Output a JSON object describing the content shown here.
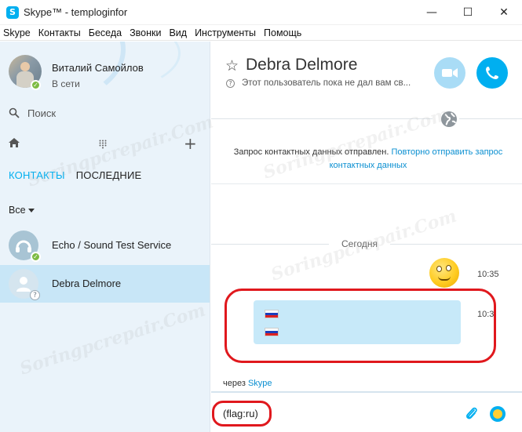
{
  "window": {
    "title": "Skype™ - temploginfor",
    "minimize": "—",
    "maximize": "☐",
    "close": "✕"
  },
  "menu": [
    "Skype",
    "Контакты",
    "Беседа",
    "Звонки",
    "Вид",
    "Инструменты",
    "Помощь"
  ],
  "profile": {
    "name": "Виталий Самойлов",
    "status": "В сети"
  },
  "search": {
    "label": "Поиск"
  },
  "tabs": {
    "contacts": "КОНТАКТЫ",
    "recent": "ПОСЛЕДНИЕ"
  },
  "filter": {
    "label": "Все"
  },
  "contacts": [
    {
      "name": "Echo / Sound Test Service",
      "status": "online"
    },
    {
      "name": "Debra Delmore",
      "status": "unknown",
      "selected": true
    }
  ],
  "chat": {
    "contact_name": "Debra Delmore",
    "mood": "Этот пользователь пока не дал вам св...",
    "notice_text": "Запрос контактных данных отправлен.",
    "notice_link": "Повторно отправить запрос контактных данных",
    "today": "Сегодня",
    "messages": [
      {
        "type": "emoticon",
        "time": "10:35"
      },
      {
        "type": "flags",
        "flag": "ru",
        "count": 2,
        "time": "10:3"
      }
    ],
    "via_prefix": "через",
    "via_link": "Skype",
    "input_value": "(flag:ru)"
  },
  "watermark": "Soringpcrepair.Com",
  "colors": {
    "accent": "#00aff0",
    "selected_row": "#c8e6f7",
    "sidebar_bg": "#eaf3fa",
    "bubble": "#c7e9f9",
    "highlight": "#e0181d"
  }
}
